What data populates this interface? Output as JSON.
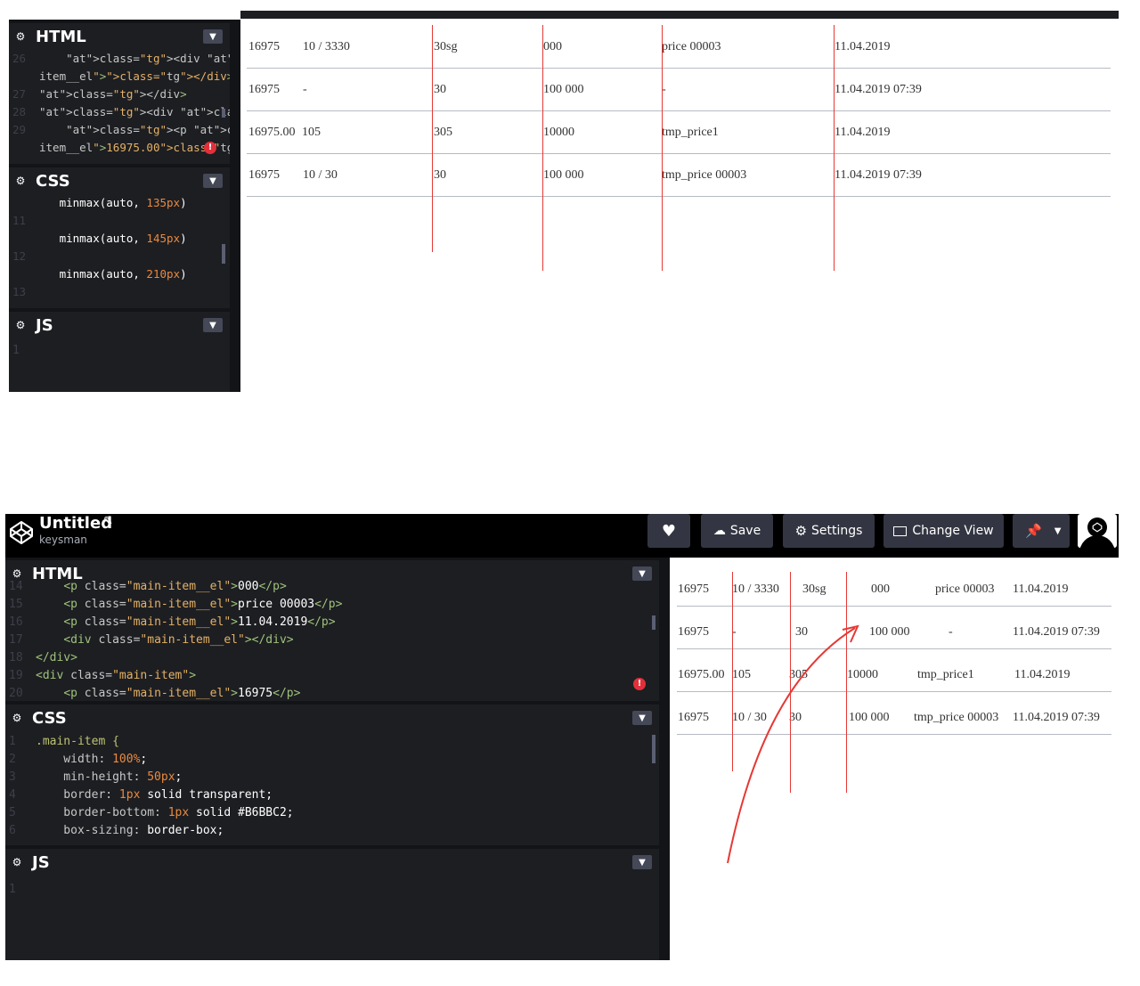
{
  "top": {
    "html_pane": {
      "title": "HTML",
      "lines": [
        {
          "n": "26",
          "code": "    <div class=\"main-"
        },
        {
          "n": "",
          "code": "item__el\"></div>"
        },
        {
          "n": "27",
          "code": "</div>"
        },
        {
          "n": "28",
          "code": "<div class=\"main-item\">"
        },
        {
          "n": "29",
          "code": "    <p class=\"main-"
        },
        {
          "n": "",
          "code": "item__el\">16975.00</p>"
        }
      ]
    },
    "css_pane": {
      "title": "CSS",
      "lines": [
        {
          "n": "",
          "fn": "minmax(auto, ",
          "num": "135px",
          "end": ")"
        },
        {
          "n": "11",
          "fn": "",
          "num": "",
          "end": ""
        },
        {
          "n": "",
          "fn": "minmax(auto, ",
          "num": "145px",
          "end": ")"
        },
        {
          "n": "12",
          "fn": "",
          "num": "",
          "end": ""
        },
        {
          "n": "",
          "fn": "minmax(auto, ",
          "num": "210px",
          "end": ")"
        },
        {
          "n": "13",
          "fn": "",
          "num": "",
          "end": ""
        }
      ]
    },
    "js_pane": {
      "title": "JS",
      "line1": "1"
    },
    "table": [
      [
        "16975",
        "10 / 3330",
        "30sg",
        "000",
        "price 00003",
        "11.04.2019"
      ],
      [
        "16975",
        "-",
        "30",
        "100 000",
        "-",
        "11.04.2019 07:39"
      ],
      [
        "16975.00",
        "105",
        "305",
        "10000",
        "tmp_price1",
        "11.04.2019"
      ],
      [
        "16975",
        "10 / 30",
        "30",
        "100 000",
        "tmp_price 00003",
        "11.04.2019 07:39"
      ]
    ]
  },
  "bottom": {
    "header": {
      "title": "Untitled",
      "user": "keysman",
      "save_label": "Save",
      "settings_label": "Settings",
      "change_view_label": "Change View"
    },
    "html_pane": {
      "title": "HTML",
      "lines": [
        {
          "n": "14",
          "kind": "p",
          "inner": "000",
          "cut": true
        },
        {
          "n": "15",
          "kind": "p",
          "inner": "price 00003"
        },
        {
          "n": "16",
          "kind": "p",
          "inner": "11.04.2019"
        },
        {
          "n": "17",
          "kind": "div_el"
        },
        {
          "n": "18",
          "kind": "close"
        },
        {
          "n": "19",
          "kind": "div_item"
        },
        {
          "n": "20",
          "kind": "p",
          "inner": "16975",
          "cut": true
        }
      ]
    },
    "css_pane": {
      "title": "CSS",
      "lines": [
        {
          "n": "1",
          "sel": ".main-item {"
        },
        {
          "n": "2",
          "prop": "width: ",
          "num": "100%",
          "rest": ";"
        },
        {
          "n": "3",
          "prop": "min-height: ",
          "num": "50px",
          "rest": ";"
        },
        {
          "n": "4",
          "prop": "border: ",
          "num": "1px",
          "rest": " solid transparent;"
        },
        {
          "n": "5",
          "prop": "border-bottom: ",
          "num": "1px",
          "rest": " solid #B6BBC2;"
        },
        {
          "n": "6",
          "prop": "box-sizing: ",
          "num": "",
          "rest": "border-box;"
        }
      ]
    },
    "js_pane": {
      "title": "JS",
      "line1": "1"
    },
    "table": [
      [
        "16975",
        "10 / 3330",
        "30sg",
        "000",
        "price 00003",
        "11.04.2019"
      ],
      [
        "16975",
        "-",
        "30",
        "100 000",
        "-",
        "11.04.2019 07:39"
      ],
      [
        "16975.00",
        "105",
        "305",
        "10000",
        "tmp_price1",
        "11.04.2019"
      ],
      [
        "16975",
        "10 / 30",
        "30",
        "100 000",
        "tmp_price 00003",
        "11.04.2019 07:39"
      ]
    ]
  }
}
